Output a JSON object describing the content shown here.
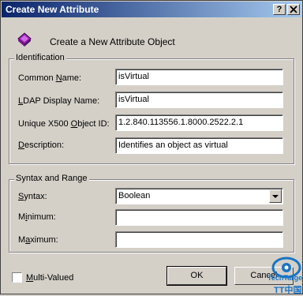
{
  "window": {
    "title": "Create New Attribute",
    "help_label": "?",
    "close_label": "X"
  },
  "header": {
    "text": "Create a New Attribute Object"
  },
  "identification": {
    "legend": "Identification",
    "common_name": {
      "label_pre": "Common ",
      "label_ul": "N",
      "label_post": "ame:",
      "value": "isVirtual"
    },
    "ldap_display_name": {
      "label_pre": "",
      "label_ul": "L",
      "label_post": "DAP Display Name:",
      "value": "isVirtual"
    },
    "unique_x500_oid": {
      "label_pre": "Unique X500 ",
      "label_ul": "O",
      "label_post": "bject ID:",
      "value": "1.2.840.113556.1.8000.2522.2.1"
    },
    "description": {
      "label_pre": "",
      "label_ul": "D",
      "label_post": "escription:",
      "value": "Identifies an object as virtual"
    }
  },
  "syntax_and_range": {
    "legend": "Syntax and Range",
    "syntax": {
      "label_pre": "",
      "label_ul": "S",
      "label_post": "yntax:",
      "selected": "Boolean"
    },
    "minimum": {
      "label_pre": "M",
      "label_ul": "i",
      "label_post": "nimum:",
      "value": ""
    },
    "maximum": {
      "label_pre": "M",
      "label_ul": "a",
      "label_post": "ximum:",
      "value": ""
    }
  },
  "footer": {
    "multi_valued": {
      "label_pre": "",
      "label_ul": "M",
      "label_post": "ulti-Valued",
      "checked": false
    },
    "ok_label": "OK",
    "cancel_label": "Cancel"
  },
  "watermark": {
    "line1": "TechTarget",
    "line2": "TT中国"
  },
  "colors": {
    "title_start": "#0a246a",
    "title_end": "#a6caf0",
    "dialog_bg": "#d4d0c8",
    "icon_purple": "#9a2ab0"
  }
}
